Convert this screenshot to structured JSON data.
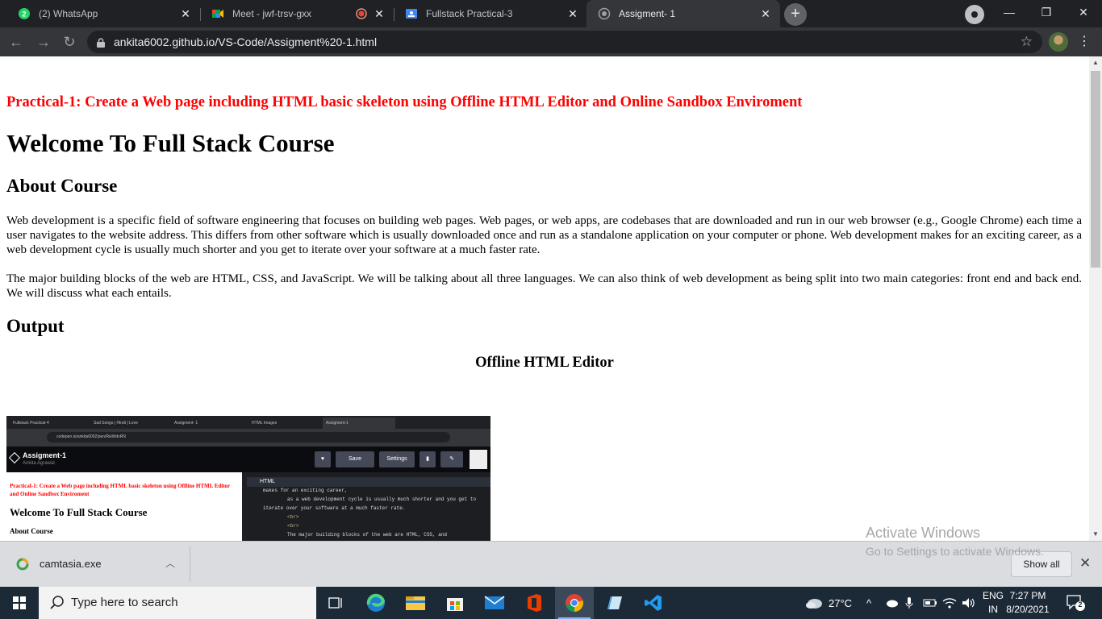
{
  "browser": {
    "tabs": [
      {
        "title": "(2) WhatsApp",
        "icon": "whatsapp-icon",
        "active": false
      },
      {
        "title": "Meet - jwf-trsv-gxx",
        "icon": "meet-icon",
        "active": false
      },
      {
        "title": "Fullstack Practical-3",
        "icon": "classroom-icon",
        "active": false
      },
      {
        "title": "Assigment- 1",
        "icon": "globe-icon",
        "active": true
      }
    ],
    "url": "ankita6002.github.io/VS-Code/Assigment%20-1.html"
  },
  "page": {
    "practical_heading": "Practical-1: Create a Web page including HTML basic skeleton using Offline HTML Editor and Online Sandbox Enviroment",
    "main_heading": "Welcome To Full Stack Course",
    "about_heading": "About Course",
    "paragraph_1": "Web development is a specific field of software engineering that focuses on building web pages. Web pages, or web apps, are codebases that are downloaded and run in our web browser (e.g., Google Chrome) each time a user navigates to the website address. This differs from other software which is usually downloaded once and run as a standalone application on your computer or phone. Web development makes for an exciting career, as a web development cycle is usually much shorter and you get to iterate over your software at a much faster rate.",
    "paragraph_2": "The major building blocks of the web are HTML, CSS, and JavaScript. We will be talking about all three languages. We can also think of web development as being split into two main categories: front end and back end. We will discuss what each entails.",
    "output_heading": "Output",
    "offline_heading": "Offline HTML Editor"
  },
  "screenshot": {
    "tabs": [
      "Fullstack Practical-4",
      "Sad Songs | Hindi | Love",
      "Assigment- 1",
      "HTML Images",
      "Assigment-1"
    ],
    "url": "codepen.io/ankita6002/pen/RwWdvRN",
    "pen_title": "Assigment-1",
    "pen_user": "Ankita Agrawal",
    "save_label": "Save",
    "settings_label": "Settings",
    "preview_red": "Practical-1: Create a Web page including HTML basic skeleton using Offline HTML Editor and Online Sandbox Enviroment",
    "preview_heading": "Welcome To Full Stack Course",
    "preview_sub": "About Course",
    "code_tab": "HTML",
    "code_lines": [
      "makes for an exciting career,",
      "as a web development cycle is usually much shorter and you get to",
      "iterate over your software at a much faster rate.",
      "<br>",
      "<br>",
      "The major building blocks of the web are HTML, CSS, and"
    ]
  },
  "downloads": {
    "file": "camtasia.exe",
    "show_all": "Show all"
  },
  "watermark": {
    "line1": "Activate Windows",
    "line2": "Go to Settings to activate Windows."
  },
  "taskbar": {
    "search_placeholder": "Type here to search",
    "weather": "27°C",
    "lang_line1": "ENG",
    "lang_line2": "IN",
    "time": "7:27 PM",
    "date": "8/20/2021",
    "notification_count": "2"
  }
}
